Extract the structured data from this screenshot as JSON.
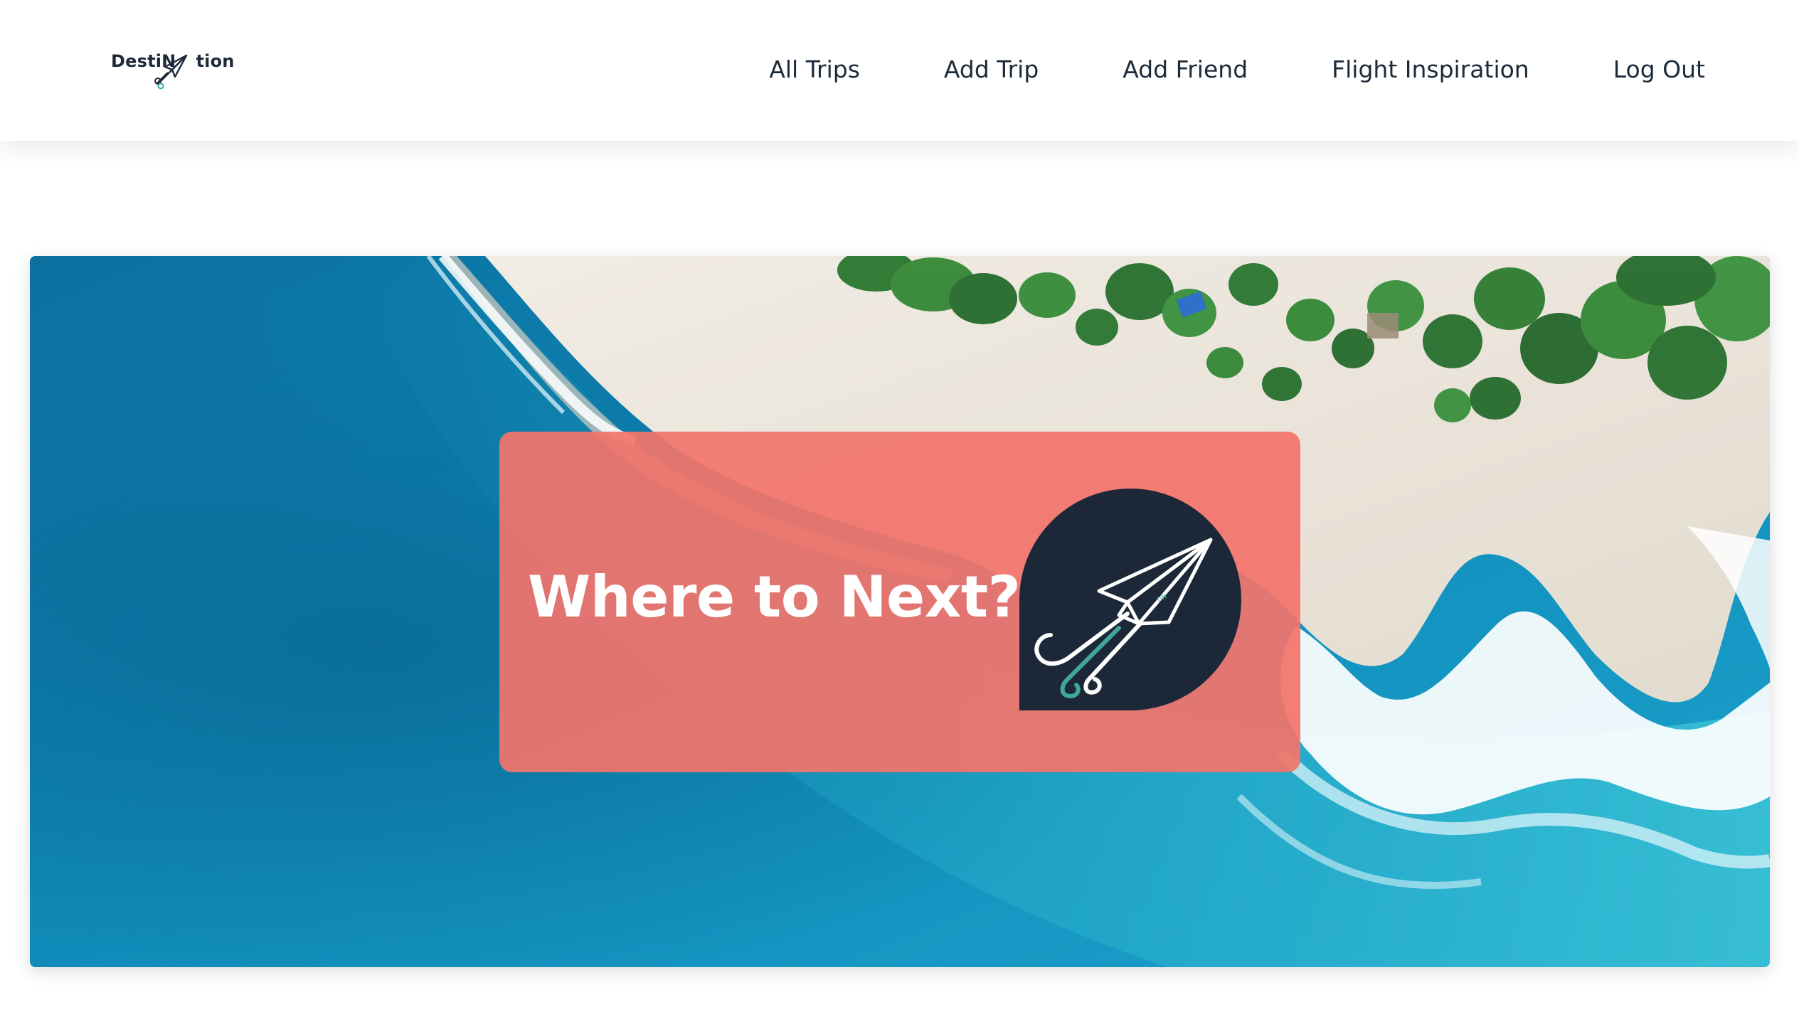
{
  "brand": {
    "logo_text_left": "DestiN",
    "logo_text_right": "tion",
    "logo_icon": "paper-plane-icon"
  },
  "nav": {
    "items": [
      {
        "label": "All Trips"
      },
      {
        "label": "Add Trip"
      },
      {
        "label": "Add Friend"
      },
      {
        "label": "Flight Inspiration"
      },
      {
        "label": "Log Out"
      }
    ]
  },
  "hero": {
    "background": "aerial-beach-photo",
    "card": {
      "title": "Where to Next?",
      "badge_icon": "paper-plane-icon"
    }
  },
  "colors": {
    "text_dark": "#1d2a3a",
    "card_coral": "#f2746c",
    "badge_navy": "#1c2838",
    "ocean": "#0f86b4",
    "sand": "#ece6dc",
    "accent_teal": "#3fa89a"
  }
}
